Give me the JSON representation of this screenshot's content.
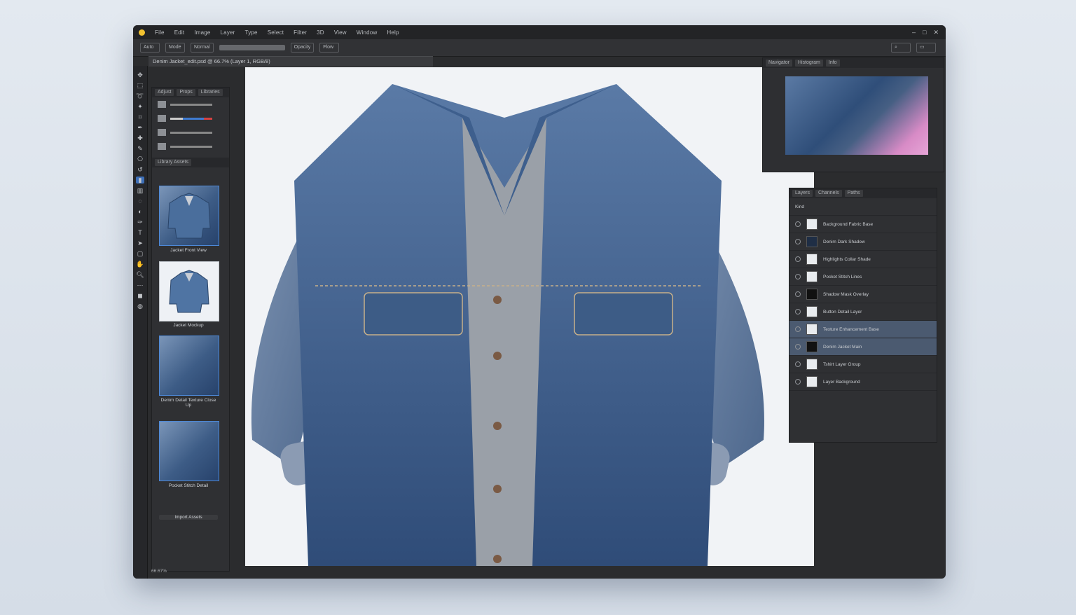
{
  "colors": {
    "accent": "#3d6fb8",
    "window_bg": "#2b2c2e",
    "canvas_bg": "#f1f3f6",
    "denim": "#3d5c86"
  },
  "menubar": {
    "items": [
      "File",
      "Edit",
      "Image",
      "Layer",
      "Type",
      "Select",
      "Filter",
      "3D",
      "View",
      "Window",
      "Help"
    ]
  },
  "optionsbar": {
    "chips": [
      "Auto",
      "Mode",
      "Normal",
      "Opacity",
      "Flow"
    ]
  },
  "document": {
    "tab_title": "Denim Jacket_edit.psd @ 66.7% (Layer 1, RGB/8)"
  },
  "left_panel": {
    "tabs": [
      "Adjust",
      "Props",
      "Libraries"
    ],
    "section_label": "Library Assets",
    "thumbs": [
      {
        "caption": "Jacket Front View"
      },
      {
        "caption": "Jacket Mockup"
      },
      {
        "caption": "Denim Detail Texture Close Up"
      },
      {
        "caption": "Pocket Stitch Detail"
      }
    ],
    "footer": "Import Assets"
  },
  "navigator": {
    "tabs": [
      "Navigator",
      "Histogram",
      "Info"
    ]
  },
  "layers": {
    "tabs": [
      "Layers",
      "Channels",
      "Paths"
    ],
    "kind_label": "Kind",
    "rows": [
      {
        "name": "Background Fabric Base",
        "thumb": "light",
        "highlighted": false
      },
      {
        "name": "Denim Dark Shadow",
        "thumb": "dark",
        "highlighted": false
      },
      {
        "name": "Highlights Collar Shade",
        "thumb": "light",
        "highlighted": false
      },
      {
        "name": "Pocket Stitch Lines",
        "thumb": "light",
        "highlighted": false
      },
      {
        "name": "Shadow Mask Overlay",
        "thumb": "black",
        "highlighted": false
      },
      {
        "name": "Button Detail Layer",
        "thumb": "light",
        "highlighted": false
      },
      {
        "name": "Texture Enhancement Base",
        "thumb": "light",
        "highlighted": true
      },
      {
        "name": "Denim Jacket Main",
        "thumb": "black",
        "highlighted": true
      },
      {
        "name": "Tshirt Layer Group",
        "thumb": "light",
        "highlighted": false
      },
      {
        "name": "Layer Background",
        "thumb": "light",
        "highlighted": false
      }
    ]
  },
  "status": {
    "zoom": "66.67%"
  }
}
